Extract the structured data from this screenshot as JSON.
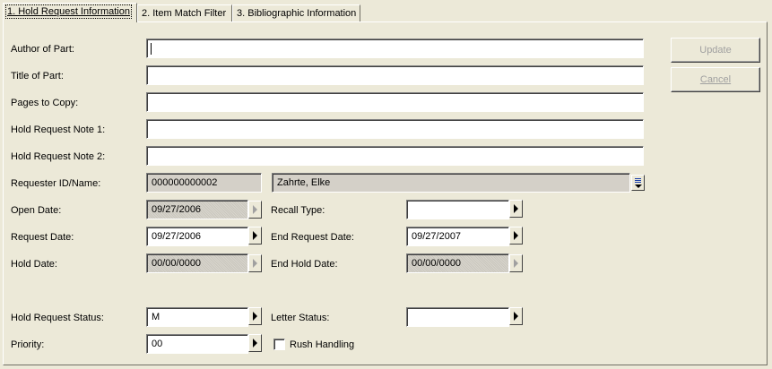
{
  "tabs": [
    {
      "label": "1. Hold Request Information"
    },
    {
      "label": "2. Item Match Filter"
    },
    {
      "label": "3. Bibliographic Information"
    }
  ],
  "form": {
    "author_label": "Author of Part:",
    "author_value": "",
    "title_label": "Title of Part:",
    "title_value": "",
    "pages_label": "Pages to Copy:",
    "pages_value": "",
    "note1_label": "Hold Request Note 1:",
    "note1_value": "",
    "note2_label": "Hold Request Note 2:",
    "note2_value": "",
    "requester_label": "Requester ID/Name:",
    "requester_id": "000000000002",
    "requester_name": "Zahrte, Elke",
    "open_date_label": "Open Date:",
    "open_date": "09/27/2006",
    "recall_type_label": "Recall Type:",
    "recall_type": "",
    "request_date_label": "Request Date:",
    "request_date": "09/27/2006",
    "end_request_label": "End Request Date:",
    "end_request_date": "09/27/2007",
    "hold_date_label": "Hold Date:",
    "hold_date": "00/00/0000",
    "end_hold_label": "End Hold Date:",
    "end_hold_date": "00/00/0000",
    "status_label": "Hold Request Status:",
    "status": "M",
    "letter_status_label": "Letter Status:",
    "letter_status": "",
    "priority_label": "Priority:",
    "priority": "00",
    "rush_label": "Rush Handling",
    "rush_checked": false
  },
  "buttons": {
    "update": "Update",
    "cancel": "Cancel"
  }
}
